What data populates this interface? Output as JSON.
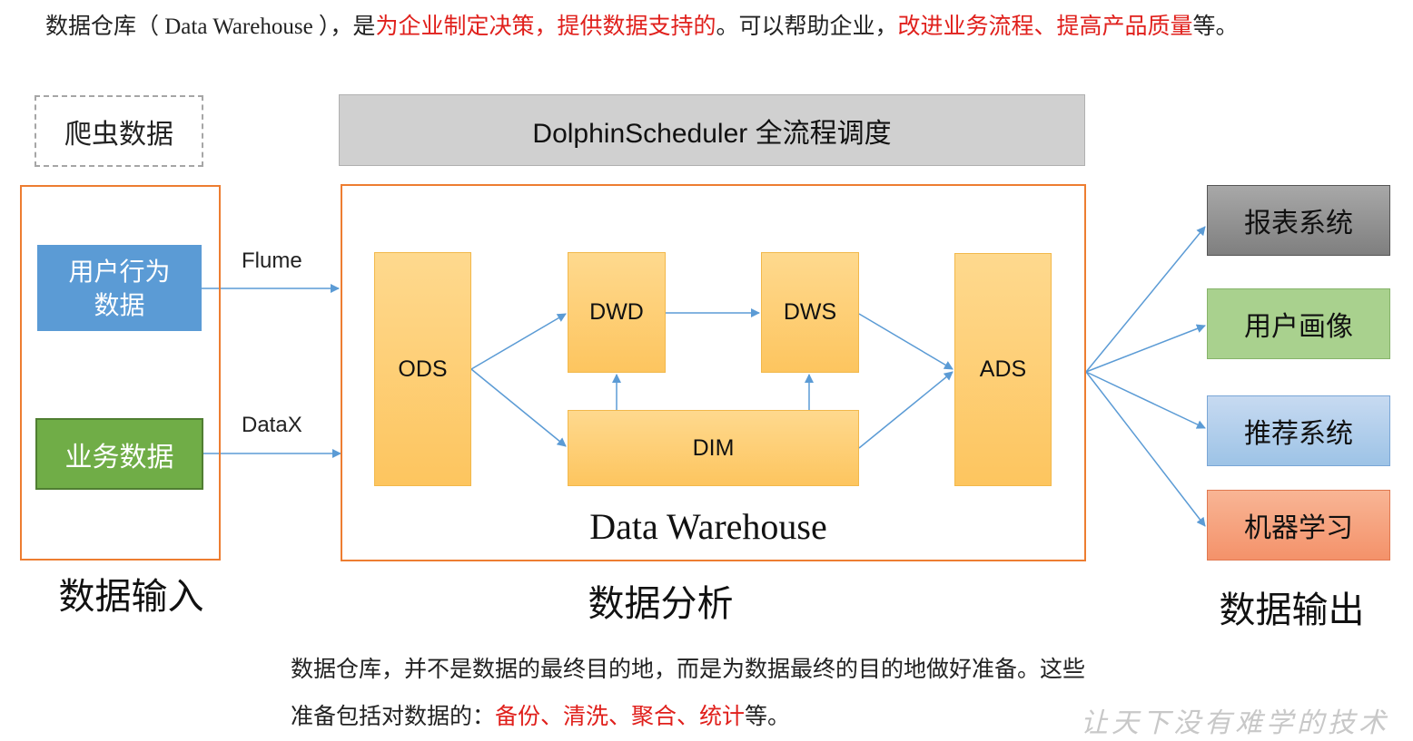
{
  "intro": {
    "p1": "数据仓库（ Data Warehouse ），是",
    "h1": "为企业制定决策，提供数据支持的",
    "p2": "。可以帮助企业，",
    "h2": "改进业务流程、提高产品质量",
    "p3": "等。"
  },
  "input": {
    "crawler": "爬虫数据",
    "user_behavior_line1": "用户行为",
    "user_behavior_line2": "数据",
    "business": "业务数据",
    "title": "数据输入",
    "flume": "Flume",
    "datax": "DataX"
  },
  "analysis": {
    "scheduler": "DolphinScheduler 全流程调度",
    "ods": "ODS",
    "dwd": "DWD",
    "dws": "DWS",
    "dim": "DIM",
    "ads": "ADS",
    "caption": "Data Warehouse",
    "title": "数据分析"
  },
  "output": {
    "report": "报表系统",
    "profile": "用户画像",
    "recommend": "推荐系统",
    "ml": "机器学习",
    "title": "数据输出"
  },
  "outro": {
    "line1": "数据仓库，并不是数据的最终目的地，而是为数据最终的目的地做好准备。这些",
    "line2a": "准备包括对数据的：",
    "line2b": "备份、清洗、聚合、统计",
    "line2c": "等。"
  },
  "watermark": "让天下没有难学的技术",
  "colors": {
    "accent_red": "#e0201c",
    "frame_orange": "#ed7d31",
    "arrow_blue": "#5b9bd5",
    "layer_fill": "#fdc55f"
  }
}
